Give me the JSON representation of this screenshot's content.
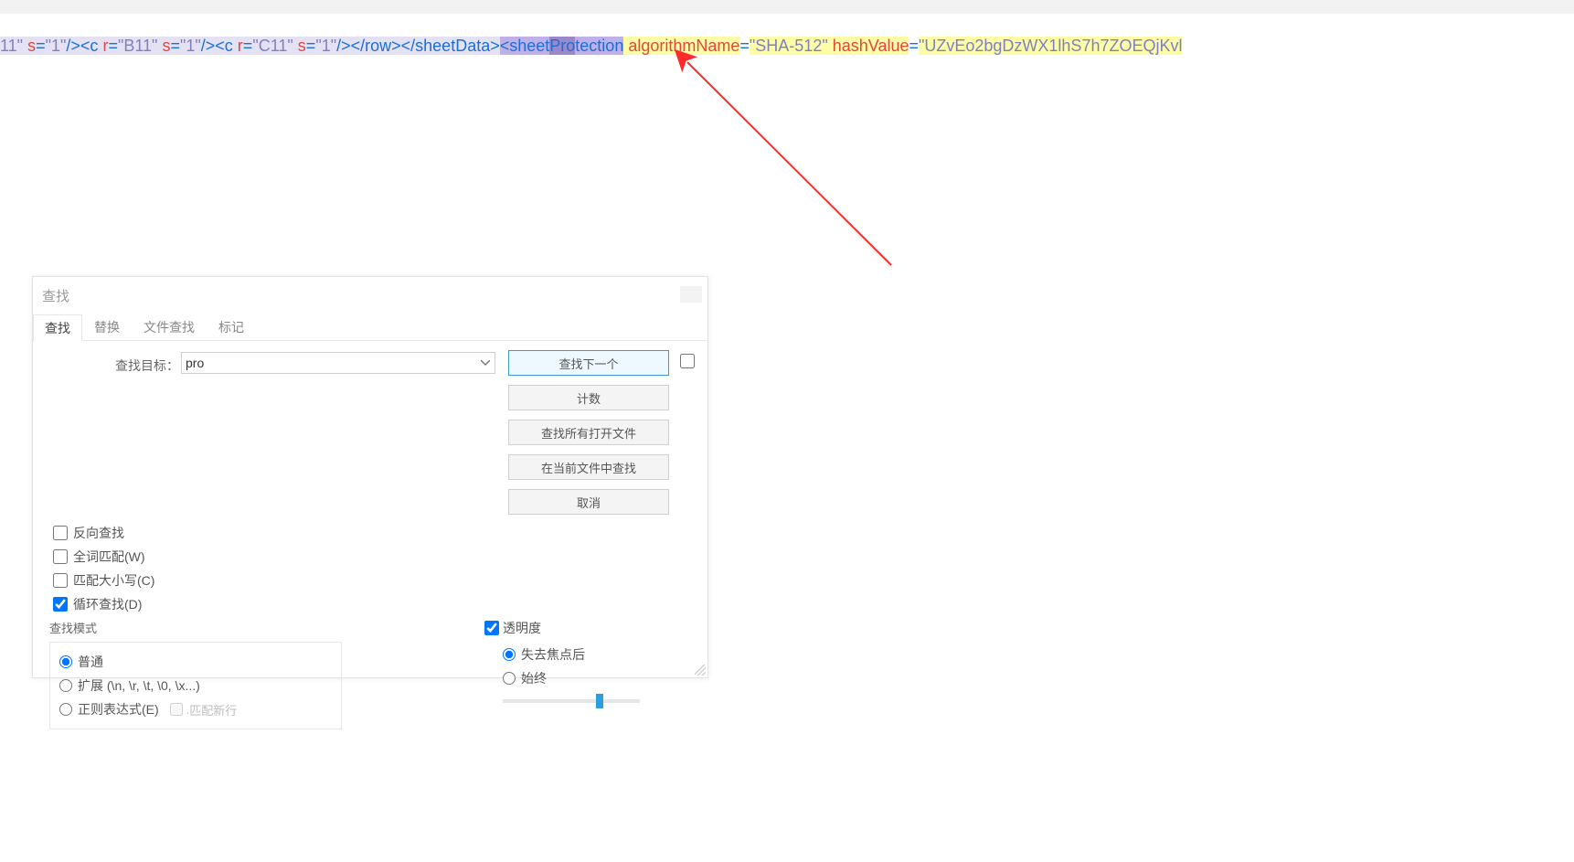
{
  "code_line": {
    "seg1_sel": "11\"",
    "seg2_attr": " s",
    "seg3_tag": "=",
    "seg4_str": "\"1\"",
    "seg5_tag": "/><c ",
    "seg6_attr": "r",
    "seg7_eq": "=",
    "seg8_str": "\"B11\"",
    "seg9_attr": " s",
    "seg10_eq": "=",
    "seg11_str": "\"1\"",
    "seg12_tag": "/><c ",
    "seg13_attr": "r",
    "seg14_eq": "=",
    "seg15_str": "\"C11\"",
    "seg16_attr": " s",
    "seg17_eq": "=",
    "seg18_str": "\"1\"",
    "seg19_tag": "/></row></sheetData>",
    "seg20_hl1": "<sheet",
    "seg20_hl2": "Pro",
    "seg20_hl3": "tection",
    "seg21_attr": " algorithmName",
    "seg22_eq": "=",
    "seg23_str": "\"SHA-512\"",
    "seg24_attr": " hashValue",
    "seg25_eq": "=",
    "seg26_str": "\"UZvEo2bgDzWX1lhS7h7ZOEQjKvl"
  },
  "dialog": {
    "title": "查找",
    "tabs": {
      "find": "查找",
      "replace": "替换",
      "file_find": "文件查找",
      "mark": "标记"
    },
    "target_label": "查找目标：",
    "target_value": "pro",
    "buttons": {
      "find_next": "查找下一个",
      "count": "计数",
      "find_all_open": "查找所有打开文件",
      "find_in_current": "在当前文件中查找",
      "cancel": "取消"
    },
    "options": {
      "reverse": "反向查找",
      "whole_word": "全词匹配(W)",
      "match_case": "匹配大小写(C)",
      "wrap": "循环查找(D)"
    },
    "mode_title": "查找模式",
    "modes": {
      "normal": "普通",
      "extended": "扩展 (\\n, \\r, \\t, \\0, \\x...)",
      "regex": "正则表达式(E)",
      "newline": "匹配新行"
    },
    "transparency": {
      "title": "透明度",
      "on_lose_focus": "失去焦点后",
      "always": "始终"
    }
  }
}
